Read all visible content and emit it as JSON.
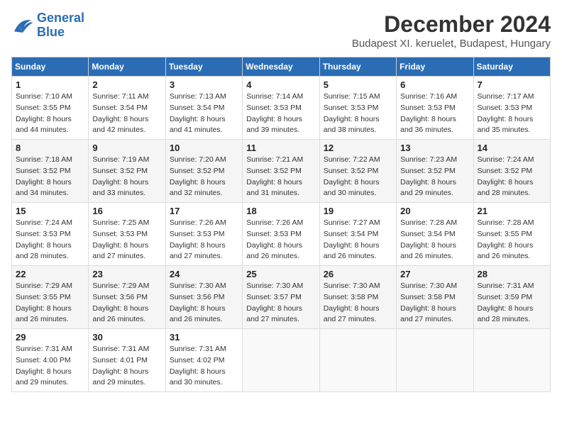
{
  "header": {
    "logo_line1": "General",
    "logo_line2": "Blue",
    "month": "December 2024",
    "location": "Budapest XI. keruelet, Budapest, Hungary"
  },
  "weekdays": [
    "Sunday",
    "Monday",
    "Tuesday",
    "Wednesday",
    "Thursday",
    "Friday",
    "Saturday"
  ],
  "weeks": [
    [
      {
        "day": "1",
        "sunrise": "7:10 AM",
        "sunset": "3:55 PM",
        "daylight": "8 hours and 44 minutes."
      },
      {
        "day": "2",
        "sunrise": "7:11 AM",
        "sunset": "3:54 PM",
        "daylight": "8 hours and 42 minutes."
      },
      {
        "day": "3",
        "sunrise": "7:13 AM",
        "sunset": "3:54 PM",
        "daylight": "8 hours and 41 minutes."
      },
      {
        "day": "4",
        "sunrise": "7:14 AM",
        "sunset": "3:53 PM",
        "daylight": "8 hours and 39 minutes."
      },
      {
        "day": "5",
        "sunrise": "7:15 AM",
        "sunset": "3:53 PM",
        "daylight": "8 hours and 38 minutes."
      },
      {
        "day": "6",
        "sunrise": "7:16 AM",
        "sunset": "3:53 PM",
        "daylight": "8 hours and 36 minutes."
      },
      {
        "day": "7",
        "sunrise": "7:17 AM",
        "sunset": "3:53 PM",
        "daylight": "8 hours and 35 minutes."
      }
    ],
    [
      {
        "day": "8",
        "sunrise": "7:18 AM",
        "sunset": "3:52 PM",
        "daylight": "8 hours and 34 minutes."
      },
      {
        "day": "9",
        "sunrise": "7:19 AM",
        "sunset": "3:52 PM",
        "daylight": "8 hours and 33 minutes."
      },
      {
        "day": "10",
        "sunrise": "7:20 AM",
        "sunset": "3:52 PM",
        "daylight": "8 hours and 32 minutes."
      },
      {
        "day": "11",
        "sunrise": "7:21 AM",
        "sunset": "3:52 PM",
        "daylight": "8 hours and 31 minutes."
      },
      {
        "day": "12",
        "sunrise": "7:22 AM",
        "sunset": "3:52 PM",
        "daylight": "8 hours and 30 minutes."
      },
      {
        "day": "13",
        "sunrise": "7:23 AM",
        "sunset": "3:52 PM",
        "daylight": "8 hours and 29 minutes."
      },
      {
        "day": "14",
        "sunrise": "7:24 AM",
        "sunset": "3:52 PM",
        "daylight": "8 hours and 28 minutes."
      }
    ],
    [
      {
        "day": "15",
        "sunrise": "7:24 AM",
        "sunset": "3:53 PM",
        "daylight": "8 hours and 28 minutes."
      },
      {
        "day": "16",
        "sunrise": "7:25 AM",
        "sunset": "3:53 PM",
        "daylight": "8 hours and 27 minutes."
      },
      {
        "day": "17",
        "sunrise": "7:26 AM",
        "sunset": "3:53 PM",
        "daylight": "8 hours and 27 minutes."
      },
      {
        "day": "18",
        "sunrise": "7:26 AM",
        "sunset": "3:53 PM",
        "daylight": "8 hours and 26 minutes."
      },
      {
        "day": "19",
        "sunrise": "7:27 AM",
        "sunset": "3:54 PM",
        "daylight": "8 hours and 26 minutes."
      },
      {
        "day": "20",
        "sunrise": "7:28 AM",
        "sunset": "3:54 PM",
        "daylight": "8 hours and 26 minutes."
      },
      {
        "day": "21",
        "sunrise": "7:28 AM",
        "sunset": "3:55 PM",
        "daylight": "8 hours and 26 minutes."
      }
    ],
    [
      {
        "day": "22",
        "sunrise": "7:29 AM",
        "sunset": "3:55 PM",
        "daylight": "8 hours and 26 minutes."
      },
      {
        "day": "23",
        "sunrise": "7:29 AM",
        "sunset": "3:56 PM",
        "daylight": "8 hours and 26 minutes."
      },
      {
        "day": "24",
        "sunrise": "7:30 AM",
        "sunset": "3:56 PM",
        "daylight": "8 hours and 26 minutes."
      },
      {
        "day": "25",
        "sunrise": "7:30 AM",
        "sunset": "3:57 PM",
        "daylight": "8 hours and 27 minutes."
      },
      {
        "day": "26",
        "sunrise": "7:30 AM",
        "sunset": "3:58 PM",
        "daylight": "8 hours and 27 minutes."
      },
      {
        "day": "27",
        "sunrise": "7:30 AM",
        "sunset": "3:58 PM",
        "daylight": "8 hours and 27 minutes."
      },
      {
        "day": "28",
        "sunrise": "7:31 AM",
        "sunset": "3:59 PM",
        "daylight": "8 hours and 28 minutes."
      }
    ],
    [
      {
        "day": "29",
        "sunrise": "7:31 AM",
        "sunset": "4:00 PM",
        "daylight": "8 hours and 29 minutes."
      },
      {
        "day": "30",
        "sunrise": "7:31 AM",
        "sunset": "4:01 PM",
        "daylight": "8 hours and 29 minutes."
      },
      {
        "day": "31",
        "sunrise": "7:31 AM",
        "sunset": "4:02 PM",
        "daylight": "8 hours and 30 minutes."
      },
      null,
      null,
      null,
      null
    ]
  ]
}
